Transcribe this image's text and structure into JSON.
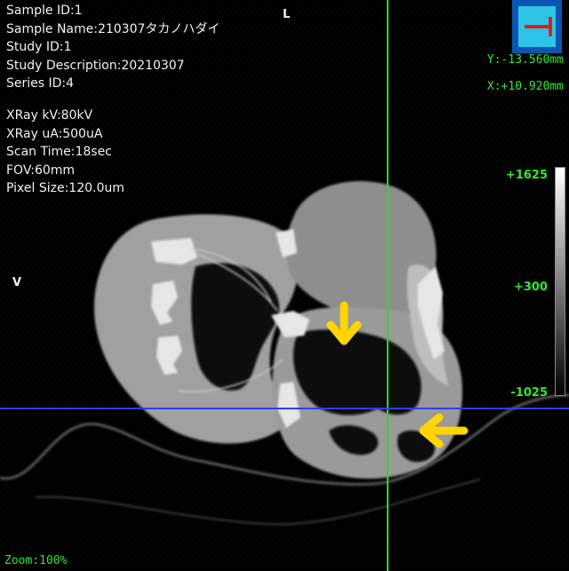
{
  "info": {
    "sample_id": "Sample ID:1",
    "sample_name": "Sample Name:210307タカノハダイ",
    "study_id": "Study ID:1",
    "study_description": "Study Description:20210307",
    "series_id": "Series ID:4",
    "xray_kv": "XRay kV:80kV",
    "xray_ua": "XRay uA:500uA",
    "scan_time": "Scan Time:18sec",
    "fov": "FOV:60mm",
    "pixel_size": "Pixel Size:120.0um"
  },
  "orientation": {
    "top": "L",
    "left": "V"
  },
  "coordinates": {
    "y": "Y:-13.560mm",
    "x": "X:+10.920mm"
  },
  "colorbar": {
    "max": "+1625",
    "mid": "+300",
    "min": "-1025"
  },
  "zoom": "Zoom:100%",
  "colors": {
    "overlay_text": "#33e833",
    "crosshair_vertical": "#2fd62f",
    "crosshair_horizontal": "#2f3df0",
    "arrow": "#ffd400",
    "orientation_tool_bg": "#2dc4e6",
    "orientation_tool_border": "#0b55b3",
    "orientation_glyph": "#e02020"
  },
  "icons": {
    "orientation_tool": "axial-plane-icon",
    "annotation_arrow": "arrow-icon"
  }
}
